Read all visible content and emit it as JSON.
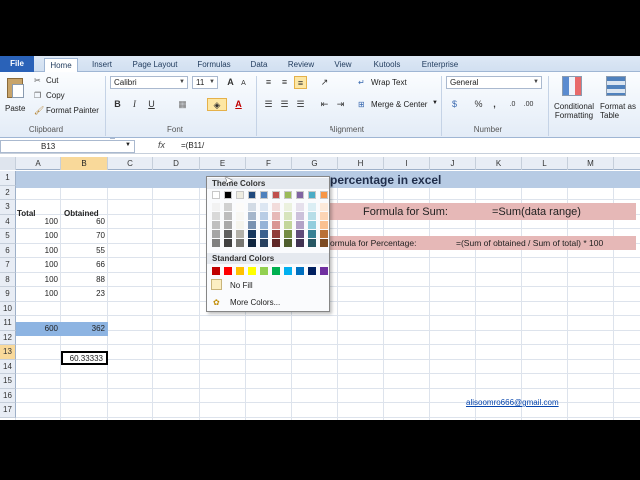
{
  "ribbon": {
    "tabs": [
      "File",
      "Home",
      "Insert",
      "Page Layout",
      "Formulas",
      "Data",
      "Review",
      "View",
      "Kutools",
      "Enterprise"
    ],
    "clipboard": {
      "paste": "Paste",
      "cut": "Cut",
      "copy": "Copy",
      "format_painter": "Format Painter",
      "label": "Clipboard"
    },
    "font": {
      "name": "Calibri",
      "size": "11",
      "label": "Font"
    },
    "alignment": {
      "wrap_text": "Wrap Text",
      "merge_center": "Merge & Center",
      "label": "Alignment"
    },
    "number": {
      "format": "General",
      "label": "Number"
    },
    "styles": {
      "conditional": "Conditional Formatting",
      "format_table": "Format as Table"
    }
  },
  "formula_bar": {
    "name_box": "B13",
    "fx": "fx",
    "content": "=(B11/"
  },
  "grid": {
    "columns": [
      "A",
      "B",
      "C",
      "D",
      "E",
      "F",
      "G",
      "H",
      "I",
      "J",
      "K",
      "L",
      "M"
    ],
    "rows": [
      "1",
      "2",
      "3",
      "4",
      "5",
      "6",
      "7",
      "8",
      "9",
      "10",
      "11",
      "12",
      "13",
      "14",
      "15",
      "16",
      "17"
    ],
    "title": "percentage in excel",
    "header_total": "Total",
    "header_obtained": "Obtained",
    "totals": [
      "100",
      "100",
      "100",
      "100",
      "100",
      "100"
    ],
    "obtained": [
      "60",
      "70",
      "55",
      "66",
      "88",
      "23"
    ],
    "sum_total": "600",
    "sum_obtained": "362",
    "result": "60.33333",
    "formula_sum_label": "Formula for Sum:",
    "formula_sum": "=Sum(data range)",
    "formula_pct_label": "ormula for Percentage:",
    "formula_pct": "=(Sum of obtained / Sum of total) * 100",
    "email": "alisoomro666@gmail.com"
  },
  "palette": {
    "theme_title": "Theme Colors",
    "standard_title": "Standard Colors",
    "no_fill": "No Fill",
    "more_colors": "More Colors...",
    "theme_top": [
      "#ffffff",
      "#000000",
      "#eeece1",
      "#1f497d",
      "#4f81bd",
      "#c0504d",
      "#9bbb59",
      "#8064a2",
      "#4bacc6",
      "#f79646"
    ],
    "standard": [
      "#c00000",
      "#ff0000",
      "#ffc000",
      "#ffff00",
      "#92d050",
      "#00b050",
      "#00b0f0",
      "#0070c0",
      "#002060",
      "#7030a0"
    ]
  }
}
